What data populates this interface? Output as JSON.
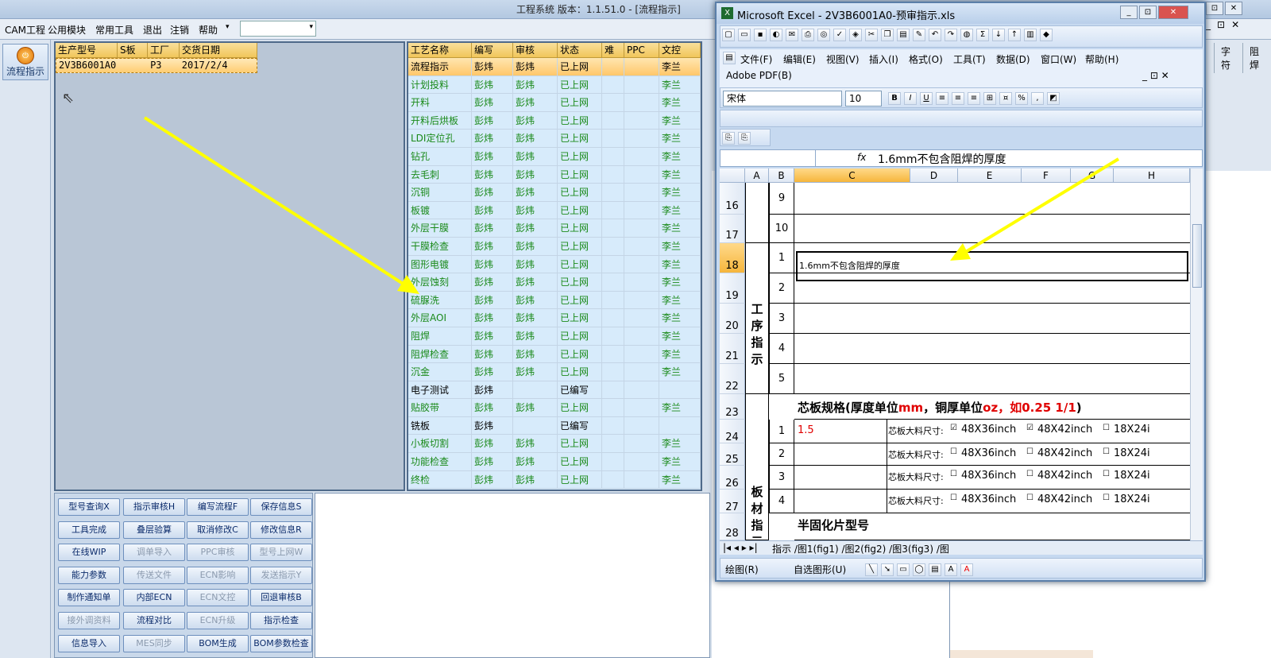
{
  "app": {
    "title": "工程系统  版本：1.1.51.0 - [流程指示]",
    "menu": [
      "CAM工程",
      "公用模块",
      "常用工具",
      "退出",
      "注销",
      "帮助"
    ],
    "right_menu": [
      "_",
      "⊡",
      "✕"
    ],
    "right_headers": [
      "字符",
      "阻焊"
    ]
  },
  "sidebar": {
    "flow_button": "流程指示"
  },
  "gridA": {
    "headers": [
      "生产型号",
      "S板",
      "工厂",
      "交货日期"
    ],
    "row": [
      "2V3B6001A0",
      "",
      "P3",
      "2017/2/4"
    ]
  },
  "gridB": {
    "headers": [
      "工艺名称",
      "编写",
      "审核",
      "状态",
      "难",
      "PPC",
      "文控"
    ],
    "rows": [
      [
        "流程指示",
        "彭炜",
        "彭炜",
        "已上网",
        "",
        "",
        "李兰"
      ],
      [
        "计划投料",
        "彭炜",
        "彭炜",
        "已上网",
        "",
        "",
        "李兰"
      ],
      [
        "开料",
        "彭炜",
        "彭炜",
        "已上网",
        "",
        "",
        "李兰"
      ],
      [
        "开料后烘板",
        "彭炜",
        "彭炜",
        "已上网",
        "",
        "",
        "李兰"
      ],
      [
        "LDI定位孔",
        "彭炜",
        "彭炜",
        "已上网",
        "",
        "",
        "李兰"
      ],
      [
        "钻孔",
        "彭炜",
        "彭炜",
        "已上网",
        "",
        "",
        "李兰"
      ],
      [
        "去毛刺",
        "彭炜",
        "彭炜",
        "已上网",
        "",
        "",
        "李兰"
      ],
      [
        "沉铜",
        "彭炜",
        "彭炜",
        "已上网",
        "",
        "",
        "李兰"
      ],
      [
        "板镀",
        "彭炜",
        "彭炜",
        "已上网",
        "",
        "",
        "李兰"
      ],
      [
        "外层干膜",
        "彭炜",
        "彭炜",
        "已上网",
        "",
        "",
        "李兰"
      ],
      [
        "干膜检查",
        "彭炜",
        "彭炜",
        "已上网",
        "",
        "",
        "李兰"
      ],
      [
        "图形电镀",
        "彭炜",
        "彭炜",
        "已上网",
        "",
        "",
        "李兰"
      ],
      [
        "外层蚀刻",
        "彭炜",
        "彭炜",
        "已上网",
        "",
        "",
        "李兰"
      ],
      [
        "硫脲洗",
        "彭炜",
        "彭炜",
        "已上网",
        "",
        "",
        "李兰"
      ],
      [
        "外层AOI",
        "彭炜",
        "彭炜",
        "已上网",
        "",
        "",
        "李兰"
      ],
      [
        "阻焊",
        "彭炜",
        "彭炜",
        "已上网",
        "",
        "",
        "李兰"
      ],
      [
        "阻焊检查",
        "彭炜",
        "彭炜",
        "已上网",
        "",
        "",
        "李兰"
      ],
      [
        "沉金",
        "彭炜",
        "彭炜",
        "已上网",
        "",
        "",
        "李兰"
      ],
      [
        "电子测试",
        "彭炜",
        "",
        "已编写",
        "",
        "",
        ""
      ],
      [
        "贴胶带",
        "彭炜",
        "彭炜",
        "已上网",
        "",
        "",
        "李兰"
      ],
      [
        "铣板",
        "彭炜",
        "",
        "已编写",
        "",
        "",
        ""
      ],
      [
        "小板切割",
        "彭炜",
        "彭炜",
        "已上网",
        "",
        "",
        "李兰"
      ],
      [
        "功能检查",
        "彭炜",
        "彭炜",
        "已上网",
        "",
        "",
        "李兰"
      ],
      [
        "终检",
        "彭炜",
        "彭炜",
        "已上网",
        "",
        "",
        "李兰"
      ]
    ],
    "black_rows": [
      18,
      20
    ]
  },
  "buttons": [
    [
      "型号查询X",
      "指示审核H",
      "编写流程F",
      "保存信息S"
    ],
    [
      "工具完成",
      "叠层验算",
      "取消修改C",
      "修改信息R"
    ],
    [
      "在线WIP",
      "调单导入",
      "PPC审核",
      "型号上网W"
    ],
    [
      "能力参数",
      "传送文件",
      "ECN影响",
      "发送指示Y"
    ],
    [
      "制作通知单",
      "内部ECN",
      "ECN文控",
      "回退审核B"
    ],
    [
      "接外调资料",
      "流程对比",
      "ECN升级",
      "指示检查"
    ],
    [
      "信息导入",
      "MES同步",
      "BOM生成",
      "BOM参数检查"
    ]
  ],
  "disabled_buttons": [
    "调单导入",
    "PPC审核",
    "型号上网W",
    "传送文件",
    "ECN影响",
    "发送指示Y",
    "ECN文控",
    "接外调资料",
    "ECN升级",
    "MES同步"
  ],
  "excel": {
    "title": "Microsoft Excel - 2V3B6001A0-预审指示.xls",
    "menu": [
      "文件(F)",
      "编辑(E)",
      "视图(V)",
      "插入(I)",
      "格式(O)",
      "工具(T)",
      "数据(D)",
      "窗口(W)",
      "帮助(H)"
    ],
    "adobe": "Adobe PDF(B)",
    "font": "宋体",
    "size": "10",
    "fx": "fx",
    "formula": "1.6mm不包含阻焊的厚度",
    "cols": [
      "A",
      "B",
      "C",
      "D",
      "E",
      "F",
      "G",
      "H"
    ],
    "rows": [
      "16",
      "17",
      "18",
      "19",
      "20",
      "21",
      "22",
      "23",
      "24",
      "25",
      "26",
      "27",
      "28"
    ],
    "b_vals": [
      "9",
      "10",
      "1",
      "2",
      "3",
      "4",
      "5",
      "",
      "1",
      "2",
      "3",
      "4",
      ""
    ],
    "section1": "工序\n指示",
    "section2": "板材\n指示",
    "c18": "1.6mm不包含阻焊的厚度",
    "row23": {
      "a": "芯板规格(厚度单位",
      "b": "mm",
      "c": "，铜厚单位",
      "d": "oz",
      "e": "，如0.25 1/1",
      ")": ")"
    },
    "c24": "1.5",
    "core_label": "芯板大料尺寸:",
    "opt1": "48X36inch",
    "opt2": "48X42inch",
    "opt3": "18X24i",
    "row28": "半固化片型号",
    "tabs": "指示 /图1(fig1) /图2(fig2) /图3(fig3) /图",
    "draw": "绘图(R)",
    "autoshape": "自选图形(U)"
  },
  "colors": {
    "accent": "#f1c65a",
    "green": "#1a8a1a",
    "arrow": "#ffff00",
    "red": "#e00000"
  }
}
